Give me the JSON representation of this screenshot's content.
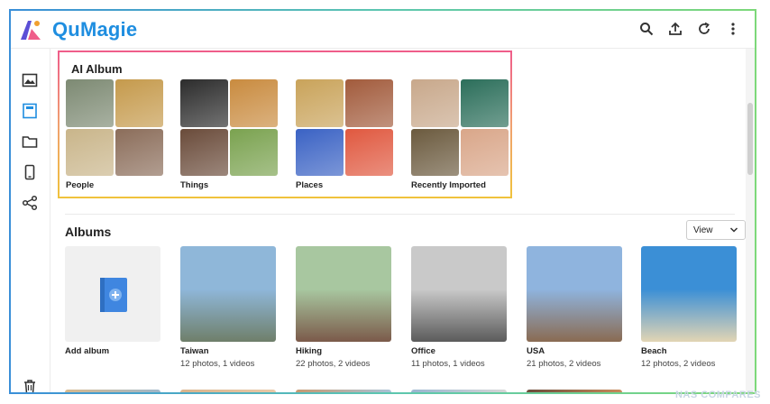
{
  "app": {
    "brand": "QuMagie"
  },
  "ai_album": {
    "title": "AI Album",
    "cards": [
      {
        "label": "People",
        "colors": [
          "#7d8a73",
          "#c59a4c",
          "#c9b58a",
          "#8b6d5a"
        ]
      },
      {
        "label": "Things",
        "colors": [
          "#2c2c2c",
          "#c98b3f",
          "#6a4b3a",
          "#7aa24f"
        ]
      },
      {
        "label": "Places",
        "colors": [
          "#c9a35a",
          "#a25b3c",
          "#3a62c4",
          "#e0583f"
        ]
      },
      {
        "label": "Recently Imported",
        "colors": [
          "#c8a88b",
          "#2b6e5a",
          "#6b5a3e",
          "#d9a689"
        ]
      }
    ]
  },
  "albums": {
    "title": "Albums",
    "view_label": "View",
    "items": [
      {
        "name": "Add album",
        "meta": ""
      },
      {
        "name": "Taiwan",
        "meta": "12 photos, 1 videos",
        "top": "#8fb7d9",
        "bottom": "#6f7f6a"
      },
      {
        "name": "Hiking",
        "meta": "22 photos, 2 videos",
        "top": "#a8c7a0",
        "bottom": "#7b5a4a"
      },
      {
        "name": "Office",
        "meta": "11 photos, 1 videos",
        "top": "#c9c9c9",
        "bottom": "#5b5b5b"
      },
      {
        "name": "USA",
        "meta": "21 photos, 2 videos",
        "top": "#8fb4de",
        "bottom": "#8a6b52"
      },
      {
        "name": "Beach",
        "meta": "12 photos, 2 videos",
        "top": "#3b8fd6",
        "bottom": "#e2d5b4"
      }
    ]
  },
  "watermark": "NAS COMPARES",
  "colors": {
    "accent": "#1f8ee0",
    "ai_border_top": "#ef5d8a",
    "ai_border_bottom": "#f0c23c"
  }
}
